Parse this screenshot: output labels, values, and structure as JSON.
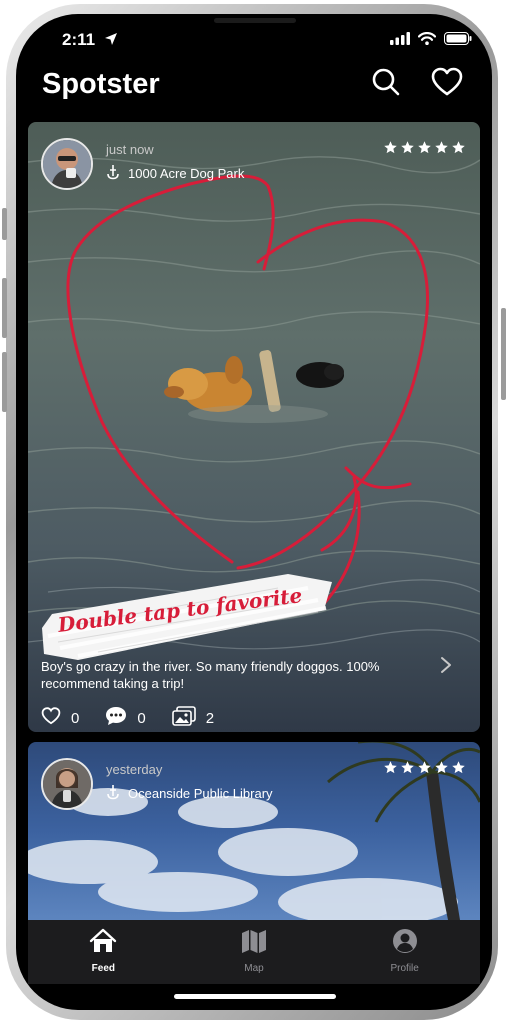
{
  "status": {
    "time": "2:11"
  },
  "app": {
    "title": "Spotster"
  },
  "header": {
    "search_icon": "search-icon",
    "favorites_icon": "heart-icon"
  },
  "posts": [
    {
      "time": "just now",
      "place": "1000 Acre Dog Park",
      "rating": 5,
      "caption": "Boy's go crazy in the river. So many friendly doggos. 100% recommend taking a trip!",
      "likes": "0",
      "comments": "0",
      "photos": "2"
    },
    {
      "time": "yesterday",
      "place": "Oceanside Public Library",
      "rating": 5
    }
  ],
  "overlay": {
    "hint": "Double tap to favorite"
  },
  "tabs": [
    {
      "label": "Feed",
      "icon": "home-icon",
      "active": true
    },
    {
      "label": "Map",
      "icon": "map-icon",
      "active": false
    },
    {
      "label": "Profile",
      "icon": "profile-icon",
      "active": false
    }
  ],
  "colors": {
    "accent_red": "#d71d39",
    "tab_active": "#ffffff",
    "tab_inactive": "#8e8e93",
    "tabbar_bg": "#1c1c1e"
  }
}
